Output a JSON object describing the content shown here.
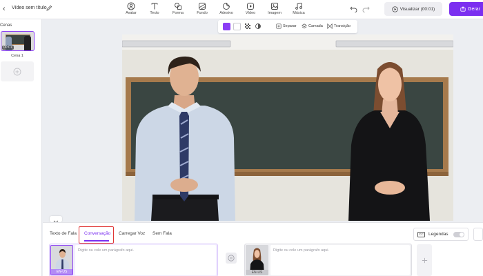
{
  "topbar": {
    "back_icon": "chevron-left-icon",
    "title": "Vídeo sem título",
    "tools": [
      {
        "label": "Avatar",
        "icon": "avatar-icon"
      },
      {
        "label": "Texto",
        "icon": "text-icon"
      },
      {
        "label": "Forma",
        "icon": "shape-icon"
      },
      {
        "label": "Fundo",
        "icon": "background-icon"
      },
      {
        "label": "Adesivo",
        "icon": "sticker-icon"
      },
      {
        "label": "Vídeo",
        "icon": "video-icon"
      },
      {
        "label": "Imagem",
        "icon": "image-icon"
      },
      {
        "label": "Música",
        "icon": "music-icon"
      }
    ],
    "preview_label": "Visualizar (00:01)",
    "generate_label": "Gerar"
  },
  "left_panel": {
    "scenes_label": "Cenas",
    "scene": {
      "duration": "00:01",
      "name": "Cena 1"
    }
  },
  "float_toolbar": {
    "separate_label": "Separar",
    "layer_label": "Camada",
    "transition_label": "Transição"
  },
  "bottom_panel": {
    "tabs": [
      {
        "label": "Texto de Fala",
        "active": false
      },
      {
        "label": "Conversação",
        "active": true
      },
      {
        "label": "Carregar Voz",
        "active": false
      },
      {
        "label": "Sem Fala",
        "active": false
      }
    ],
    "captions_label": "Legendas",
    "captions_icon_text": "CC",
    "blocks": [
      {
        "lang": "EN-US",
        "placeholder": "Digite ou cole um parágrafo aqui."
      },
      {
        "lang": "EN-US",
        "placeholder": "Digite ou cole um parágrafo aqui."
      }
    ]
  },
  "colors": {
    "accent": "#7b2ff0",
    "highlight_box": "#e03535",
    "chalkboard": "#3a4642",
    "board_frame": "#a67a4c"
  }
}
